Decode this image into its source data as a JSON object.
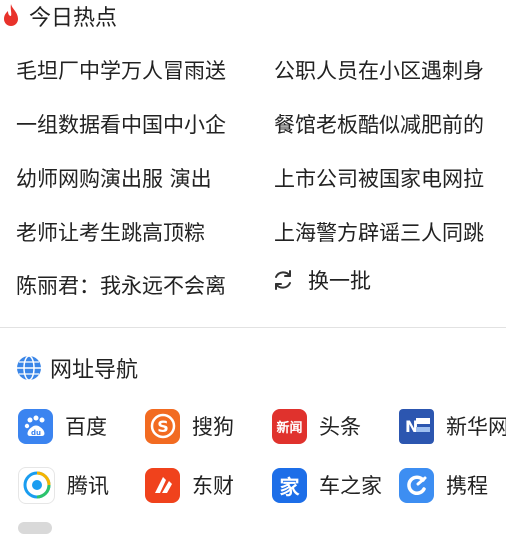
{
  "hot": {
    "title": "今日热点",
    "icon": "flame-icon",
    "accent": "#e8322b",
    "items_left": [
      "毛坦厂中学万人冒雨送",
      "一组数据看中国中小企",
      "幼师网购演出服 演出",
      "老师让考生跳高顶粽",
      "陈丽君：我永远不会离"
    ],
    "items_right": [
      "公职人员在小区遇刺身",
      "餐馆老板酷似减肥前的",
      "上市公司被国家电网拉",
      "上海警方辟谣三人同跳"
    ],
    "refresh_label": "换一批"
  },
  "nav": {
    "title": "网址导航",
    "icon": "globe-icon",
    "sites": [
      {
        "label": "百度",
        "icon": "baidu-icon",
        "color": "#3b84f0"
      },
      {
        "label": "搜狗",
        "icon": "sogou-icon",
        "color": "#f26b21"
      },
      {
        "label": "头条",
        "icon": "toutiao-icon",
        "color": "#e0322d",
        "glyph": "新闻"
      },
      {
        "label": "新华网",
        "icon": "xinhua-icon",
        "color": "#2c56b0"
      },
      {
        "label": "腾讯",
        "icon": "tencent-icon",
        "color": "#ffffff"
      },
      {
        "label": "东财",
        "icon": "eastmoney-icon",
        "color": "#f0421c"
      },
      {
        "label": "车之家",
        "icon": "autohome-icon",
        "color": "#1d6ee8",
        "glyph": "家"
      },
      {
        "label": "携程",
        "icon": "ctrip-icon",
        "color": "#3d8ef2"
      }
    ]
  }
}
